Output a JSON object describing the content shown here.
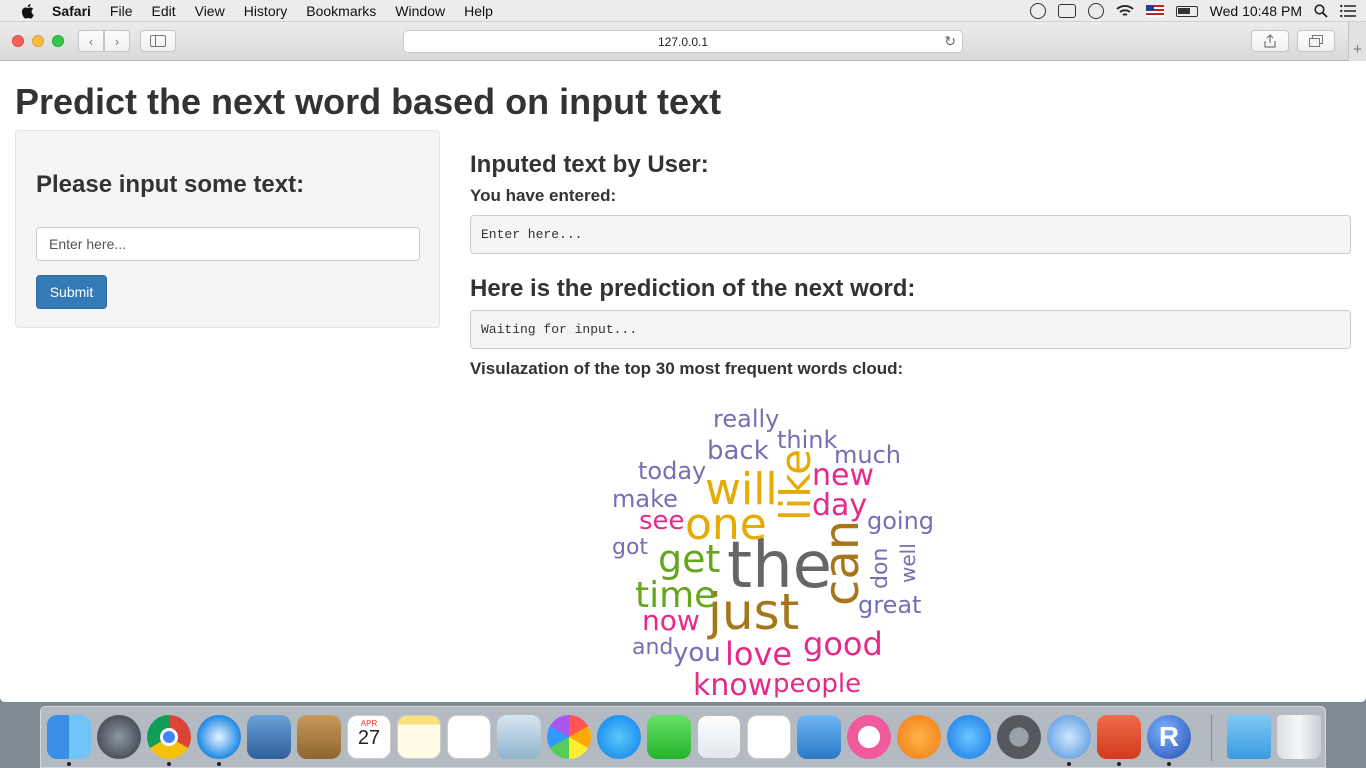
{
  "menubar": {
    "app": "Safari",
    "items": [
      "File",
      "Edit",
      "View",
      "History",
      "Bookmarks",
      "Window",
      "Help"
    ],
    "clock": "Wed 10:48 PM"
  },
  "browser": {
    "url": "127.0.0.1"
  },
  "page": {
    "title": "Predict the next word based on input text",
    "sidebar": {
      "heading": "Please input some text:",
      "input_placeholder": "Enter here...",
      "submit_label": "Submit"
    },
    "main": {
      "inputted_heading": "Inputed text by User:",
      "entered_label": "You have entered:",
      "entered_value": "Enter here...",
      "prediction_heading": "Here is the prediction of the next word:",
      "prediction_value": "Waiting for input...",
      "cloud_label": "Visulazation of the top 30 most frequent words cloud:"
    }
  },
  "word_cloud": {
    "colors": {
      "gray": "#666666",
      "gold": "#e6ab02",
      "brown": "#a6761d",
      "green": "#66a61e",
      "magenta": "#e7298a",
      "purple": "#7570b3"
    },
    "words": [
      {
        "text": "the",
        "color": "#666666",
        "orientation": "horizontal"
      },
      {
        "text": "just",
        "color": "#a6761d",
        "orientation": "horizontal"
      },
      {
        "text": "can",
        "color": "#a6761d",
        "orientation": "vertical"
      },
      {
        "text": "one",
        "color": "#e6ab02",
        "orientation": "horizontal"
      },
      {
        "text": "will",
        "color": "#e6ab02",
        "orientation": "horizontal"
      },
      {
        "text": "like",
        "color": "#e6ab02",
        "orientation": "vertical"
      },
      {
        "text": "get",
        "color": "#66a61e",
        "orientation": "horizontal"
      },
      {
        "text": "time",
        "color": "#66a61e",
        "orientation": "horizontal"
      },
      {
        "text": "good",
        "color": "#e7298a",
        "orientation": "horizontal"
      },
      {
        "text": "love",
        "color": "#e7298a",
        "orientation": "horizontal"
      },
      {
        "text": "know",
        "color": "#e7298a",
        "orientation": "horizontal"
      },
      {
        "text": "new",
        "color": "#e7298a",
        "orientation": "horizontal"
      },
      {
        "text": "day",
        "color": "#e7298a",
        "orientation": "horizontal"
      },
      {
        "text": "now",
        "color": "#e7298a",
        "orientation": "horizontal"
      },
      {
        "text": "see",
        "color": "#e7298a",
        "orientation": "horizontal"
      },
      {
        "text": "people",
        "color": "#e7298a",
        "orientation": "horizontal"
      },
      {
        "text": "back",
        "color": "#7570b3",
        "orientation": "horizontal"
      },
      {
        "text": "really",
        "color": "#7570b3",
        "orientation": "horizontal"
      },
      {
        "text": "think",
        "color": "#7570b3",
        "orientation": "horizontal"
      },
      {
        "text": "much",
        "color": "#7570b3",
        "orientation": "horizontal"
      },
      {
        "text": "today",
        "color": "#7570b3",
        "orientation": "horizontal"
      },
      {
        "text": "make",
        "color": "#7570b3",
        "orientation": "horizontal"
      },
      {
        "text": "going",
        "color": "#7570b3",
        "orientation": "horizontal"
      },
      {
        "text": "got",
        "color": "#7570b3",
        "orientation": "horizontal"
      },
      {
        "text": "don",
        "color": "#7570b3",
        "orientation": "vertical"
      },
      {
        "text": "well",
        "color": "#7570b3",
        "orientation": "vertical"
      },
      {
        "text": "great",
        "color": "#7570b3",
        "orientation": "horizontal"
      },
      {
        "text": "and",
        "color": "#7570b3",
        "orientation": "horizontal"
      },
      {
        "text": "you",
        "color": "#7570b3",
        "orientation": "horizontal"
      }
    ]
  },
  "dock": {
    "apps": [
      "finder-icon",
      "launchpad-icon",
      "chrome-icon",
      "safari-icon",
      "preview-icon",
      "contacts-icon",
      "calendar-icon",
      "notes-icon",
      "reminders-icon",
      "photo-booth-icon",
      "photos-icon",
      "messages-icon",
      "facetime-icon",
      "pages-icon",
      "numbers-icon",
      "keynote-icon",
      "itunes-icon",
      "ibooks-icon",
      "app-store-icon",
      "system-preferences-icon",
      "network-lock-icon",
      "remote-desktop-icon",
      "r-icon",
      "downloads-folder-icon",
      "trash-icon"
    ],
    "calendar_month": "APR",
    "calendar_day": "27",
    "r_letter": "R"
  }
}
